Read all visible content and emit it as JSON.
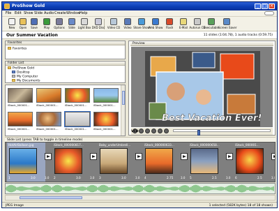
{
  "window": {
    "title": "ProShow Gold"
  },
  "menu": [
    "File",
    "Edit",
    "Show",
    "Slide",
    "Audio",
    "Create",
    "Window",
    "Help"
  ],
  "toolbar": [
    {
      "label": "New",
      "icon": "new-icon",
      "color": "#f2f2f2"
    },
    {
      "label": "Open",
      "icon": "open-icon",
      "color": "#e8c15a"
    },
    {
      "label": "Save",
      "icon": "save-icon",
      "color": "#4f6fb5"
    },
    {
      "label": "Play",
      "icon": "play-icon",
      "color": "#3a9a3a"
    },
    {
      "label": "Options",
      "icon": "options-icon",
      "color": "#7a7a9a"
    },
    {
      "label": "Slide",
      "icon": "slide-icon",
      "color": "#6a8ac8"
    },
    {
      "label": "Light Box",
      "icon": "lightbox-icon",
      "color": "#d8d8d8"
    },
    {
      "label": "DVD Disc",
      "icon": "dvd-icon",
      "color": "#c8c8d8"
    },
    {
      "label": "Video CD",
      "icon": "vcd-icon",
      "color": "#b8c8d8"
    },
    {
      "label": "Video",
      "icon": "video-icon",
      "color": "#5a7ab8"
    },
    {
      "label": "Share Show",
      "icon": "share-icon",
      "color": "#4a9ad8"
    },
    {
      "label": "Web Show",
      "icon": "web-icon",
      "color": "#3a7ad0"
    },
    {
      "label": "Flash",
      "icon": "flash-icon",
      "color": "#d84a2a"
    },
    {
      "label": "E-Mail",
      "icon": "email-icon",
      "color": "#e8d87a"
    },
    {
      "label": "Autorun CD",
      "icon": "autorun-icon",
      "color": "#c8c8c8"
    },
    {
      "label": "Executable",
      "icon": "executable-icon",
      "color": "#5aa05a"
    },
    {
      "label": "Screen Saver",
      "icon": "screensaver-icon",
      "color": "#5a8ac8"
    }
  ],
  "project": {
    "title": "Our Summer Vacation",
    "stats": "11 slides (1:04.78), 1 audio tracks (0:59.75)"
  },
  "favorites": {
    "title": "Favorites",
    "items": [
      "Favorites"
    ]
  },
  "folders": {
    "title": "Folder List",
    "items": [
      "ProShow Gold",
      "Desktop",
      "My Computer",
      "My Documents"
    ]
  },
  "browser": {
    "thumbs": [
      "iStock_000001...",
      "iStock_000001...",
      "iStock_000001...",
      "iStock_000001...",
      "iStock_000001...",
      "iStock_000001...",
      "iStock_000001...",
      "iStock_000001..."
    ],
    "selected_index": 6
  },
  "preview": {
    "title": "Preview",
    "caption": "Best Vacation Ever!",
    "format": "VCD",
    "position": 0.25
  },
  "slidelist": {
    "title": "Slide List (press TAB to toggle in timeline mode)",
    "slides": [
      {
        "name": "HotAirBalloon.jpg",
        "num": "1",
        "dur": "3.0",
        "trans": "3.0"
      },
      {
        "name": "iStock_000000817...",
        "num": "2",
        "dur": "3.0",
        "trans": "3.0"
      },
      {
        "name": "Baby_underUmbrell...",
        "num": "3",
        "dur": "3.0",
        "trans": "3.0"
      },
      {
        "name": "iStock_000000633...",
        "num": "4",
        "dur": "2.75",
        "trans": "3.0"
      },
      {
        "name": "iStock_000000658...",
        "num": "5",
        "dur": "2.5",
        "trans": "3.0"
      },
      {
        "name": "iStock_000001...",
        "num": "6",
        "dur": "2.5",
        "trans": "3.0"
      },
      {
        "name": "HotAirBalloon...",
        "num": "7",
        "dur": "",
        "trans": ""
      }
    ]
  },
  "status": {
    "left": "JPEG Image",
    "right": "1 selected (582K bytes) 18 of 18 shown)"
  }
}
